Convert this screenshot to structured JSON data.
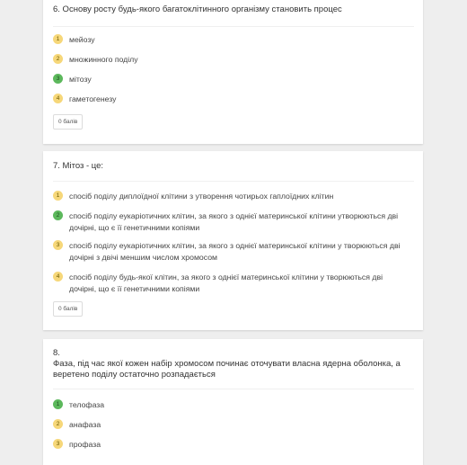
{
  "questions": [
    {
      "title": "6. Основу росту будь-якого багатоклітинного організму становить процес",
      "options": [
        {
          "num": "1",
          "text": "мейозу",
          "correct": false
        },
        {
          "num": "2",
          "text": "множинного поділу",
          "correct": false
        },
        {
          "num": "3",
          "text": "мітозу",
          "correct": true
        },
        {
          "num": "4",
          "text": "гаметогенезу",
          "correct": false
        }
      ],
      "score": "0 балів"
    },
    {
      "title": "7. Мітоз - це:",
      "options": [
        {
          "num": "1",
          "text": "спосіб поділу диплоїдної клітини з утворення чотирьох гаплоїдних клітин",
          "correct": false
        },
        {
          "num": "2",
          "text": "спосіб поділу еукаріотичних клітин, за якого з однієї материнської клітини утворюються дві дочірні, що є її генетичними копіями",
          "correct": true
        },
        {
          "num": "3",
          "text": "спосіб поділу еукаріотичних клітин, за якого з однієї материнської клітини у творюються дві дочірні з двічі меншим числом хромосом",
          "correct": false
        },
        {
          "num": "4",
          "text": "спосіб поділу будь-якої клітин, за якого з однієї материнської клітини у творюються дві дочірні, що є її генетичними копіями",
          "correct": false
        }
      ],
      "score": "0 балів"
    },
    {
      "title_number": "8.",
      "title": "Фаза, під час якої кожен набір хромосом починає оточувати власна ядерна оболонка, а веретено поділу остаточно розпадається",
      "options": [
        {
          "num": "1",
          "text": "телофаза",
          "correct": true
        },
        {
          "num": "2",
          "text": "анафаза",
          "correct": false
        },
        {
          "num": "3",
          "text": "профаза",
          "correct": false
        }
      ]
    }
  ],
  "colors": {
    "page_bg": "#eeeeee",
    "card_bg": "#ffffff",
    "option_badge": "#f6d779",
    "correct_badge": "#5cb85c"
  }
}
